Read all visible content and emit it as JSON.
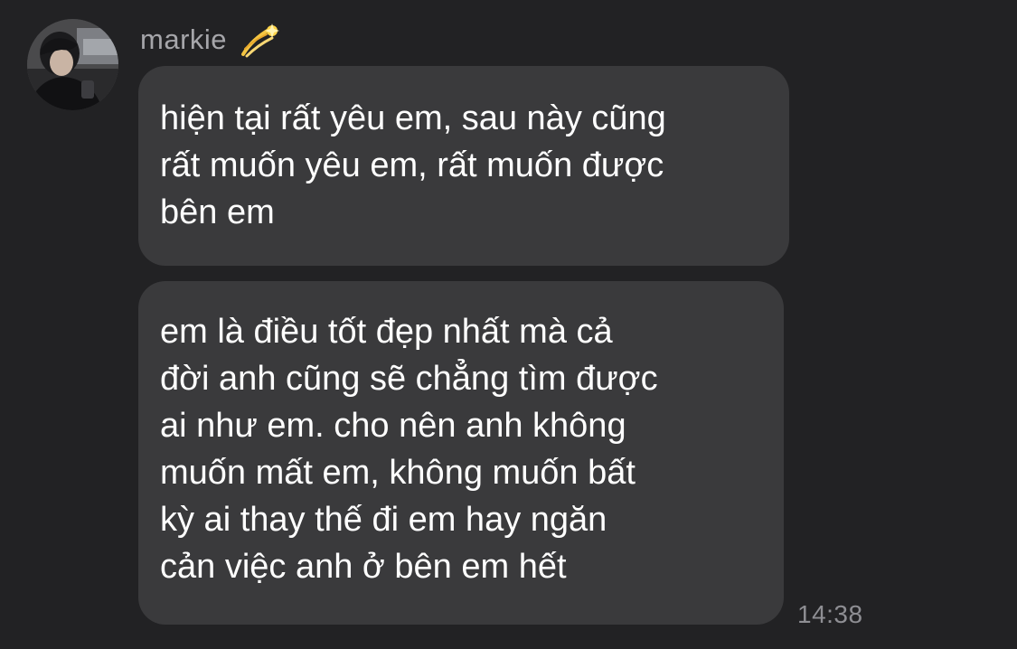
{
  "sender": {
    "name": "markie",
    "emoji_icon": "dizzy-comet-icon"
  },
  "messages": [
    {
      "lines": [
        "hiện tại rất yêu em, sau này cũng",
        "rất muốn yêu em, rất muốn được",
        "bên em"
      ]
    },
    {
      "lines": [
        "em là điều tốt đẹp nhất mà cả",
        "đời anh cũng sẽ chẳng tìm được",
        "ai như em. cho nên anh không",
        "muốn mất em, không muốn bất",
        "kỳ ai thay thế đi em hay ngăn",
        "cản việc anh ở bên em hết"
      ],
      "timestamp": "14:38"
    }
  ],
  "colors": {
    "background": "#222224",
    "bubble": "#3a3a3c",
    "message_text": "#ffffff",
    "sender_name": "#a6a6aa",
    "timestamp": "#8e8e93"
  }
}
